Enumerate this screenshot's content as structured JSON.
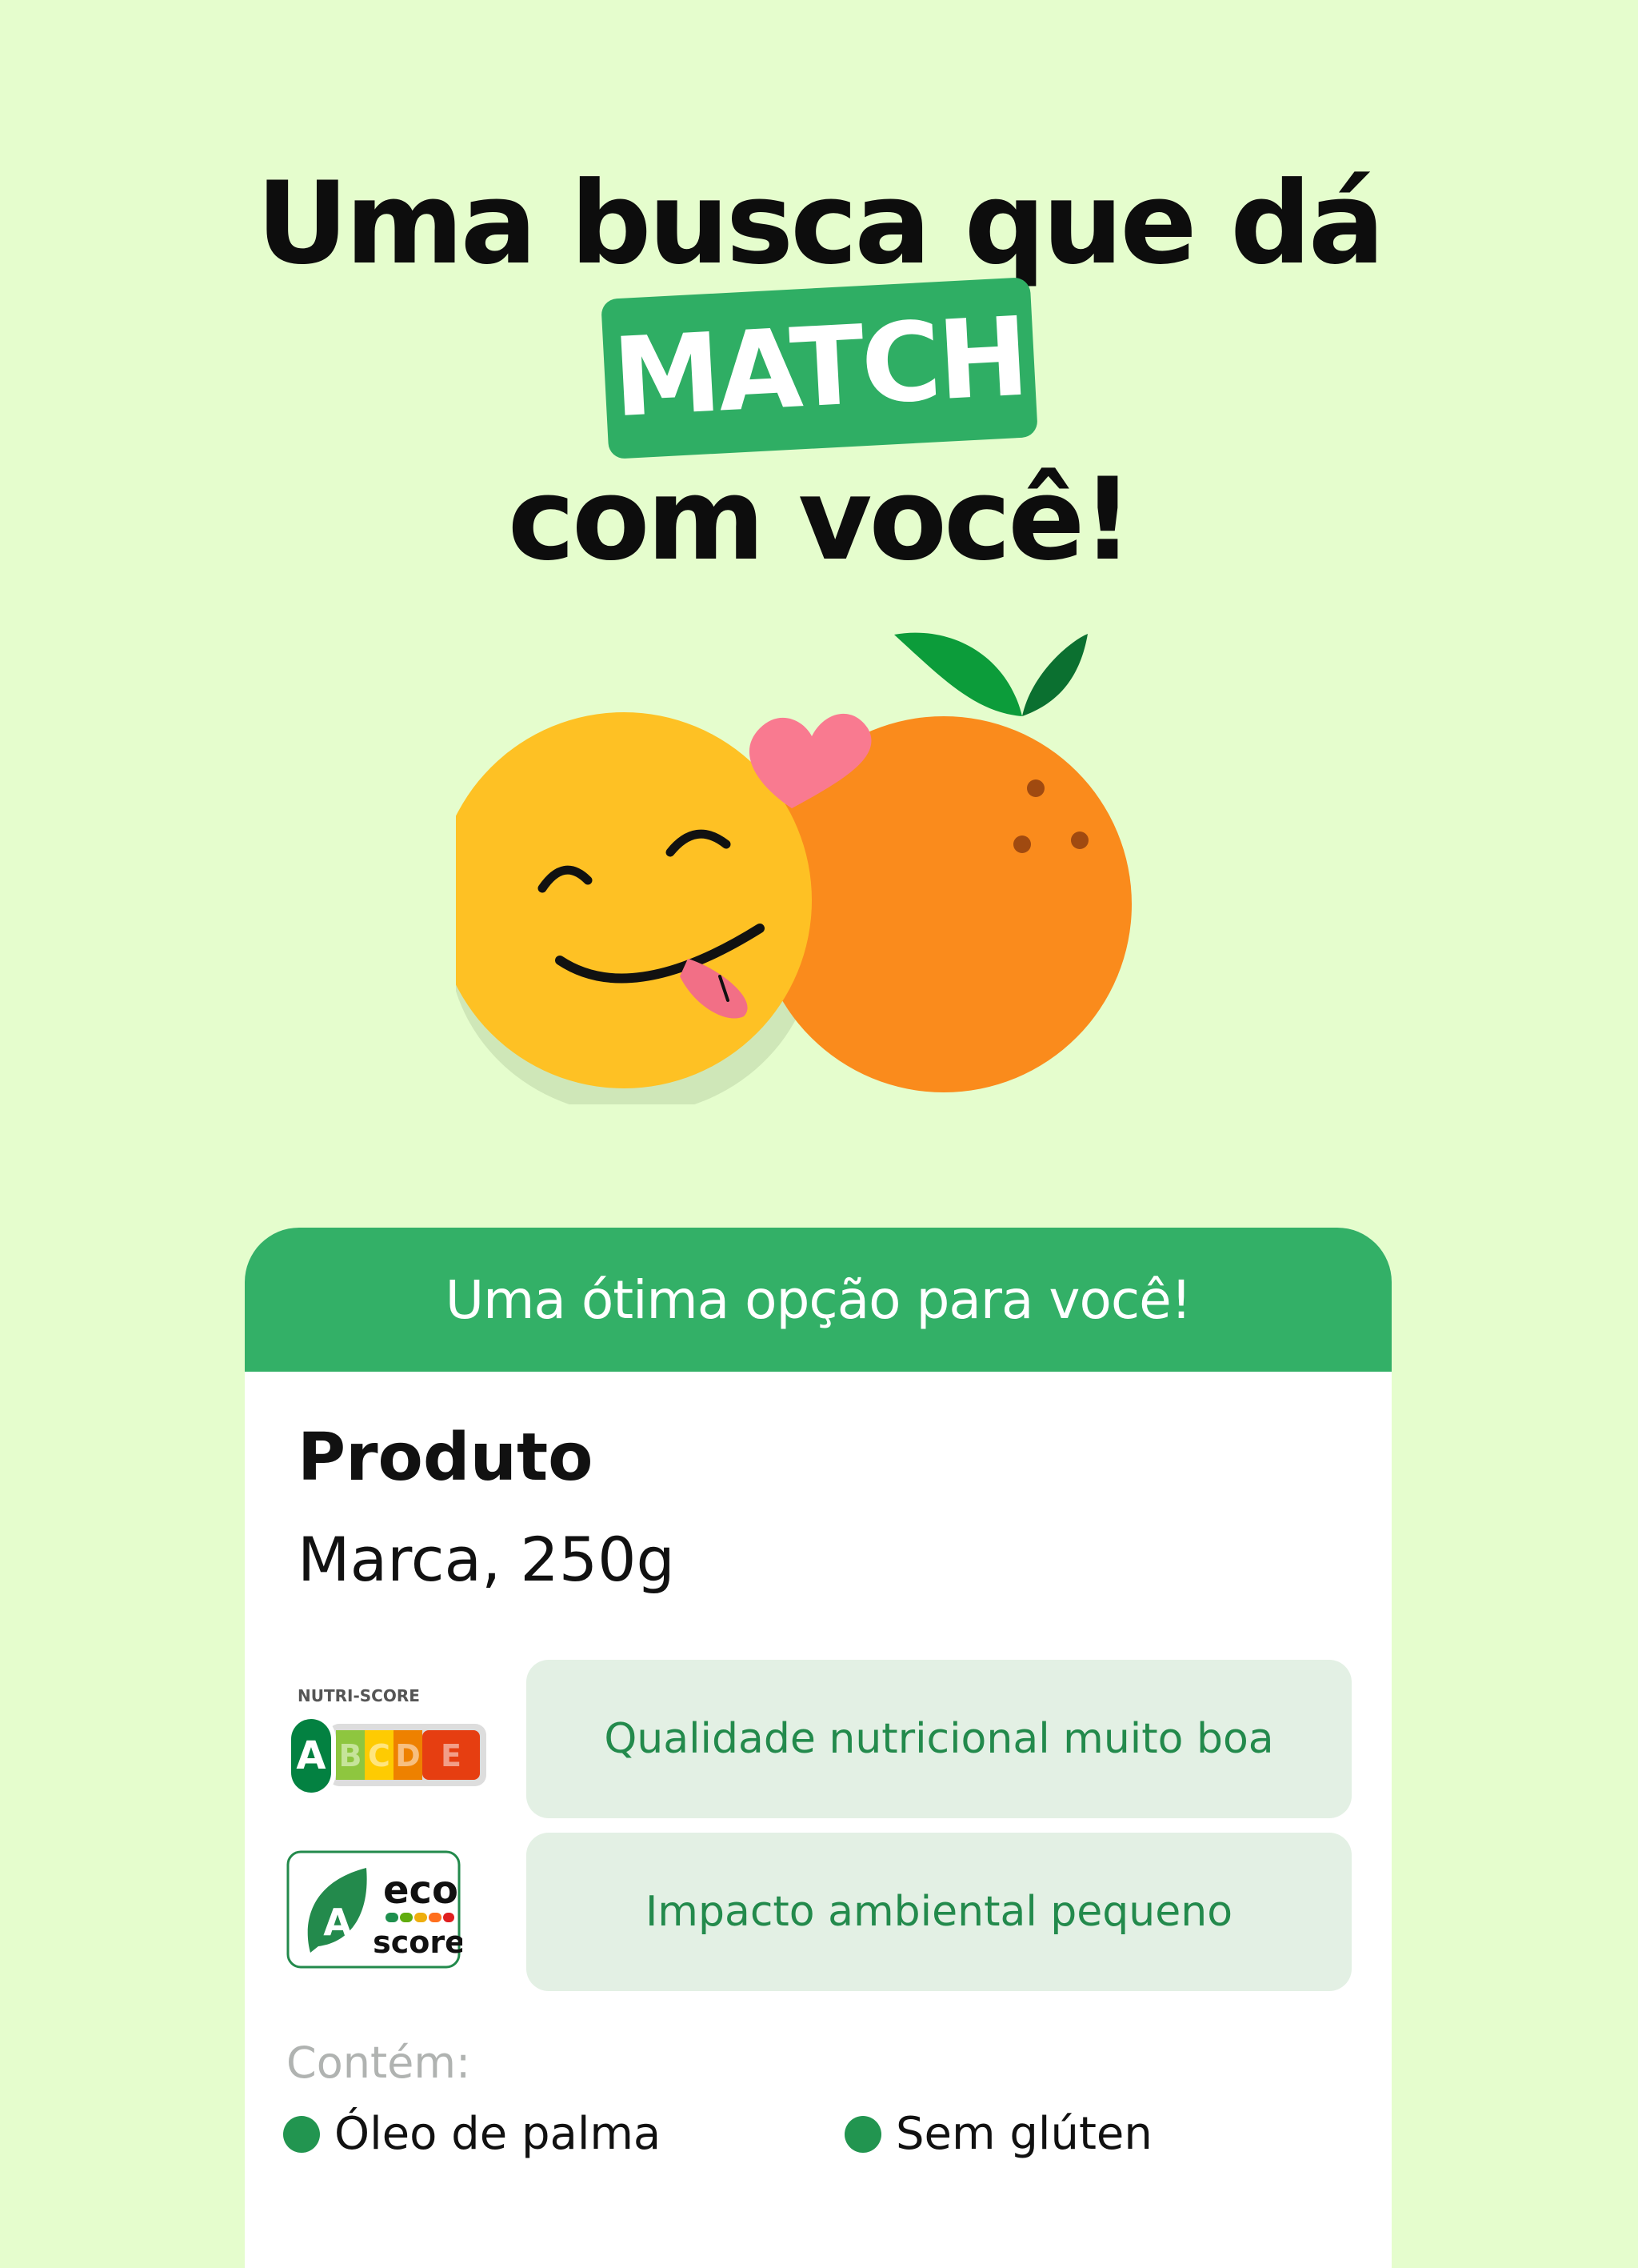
{
  "headline": {
    "line1": "Uma busca que dá",
    "badge": "MATCH",
    "line3": "com você!"
  },
  "card": {
    "banner": "Uma ótima opção para você!",
    "product_name": "Produto",
    "product_brand": "Marca, 250g",
    "nutri_score": {
      "title": "NUTRI-SCORE",
      "grades": [
        "A",
        "B",
        "C",
        "D",
        "E"
      ],
      "selected": "A",
      "label": "Qualidade nutricional muito boa"
    },
    "eco_score": {
      "grade": "A",
      "word_top": "eco",
      "word_bottom": "score",
      "label": "Impacto ambiental pequeno"
    },
    "contains_label": "Contém:",
    "contains": [
      "Óleo de palma",
      "Sem glúten"
    ]
  },
  "colors": {
    "background": "#e5fdcd",
    "brand_green": "#33b067",
    "accent_text": "#238a4c"
  }
}
